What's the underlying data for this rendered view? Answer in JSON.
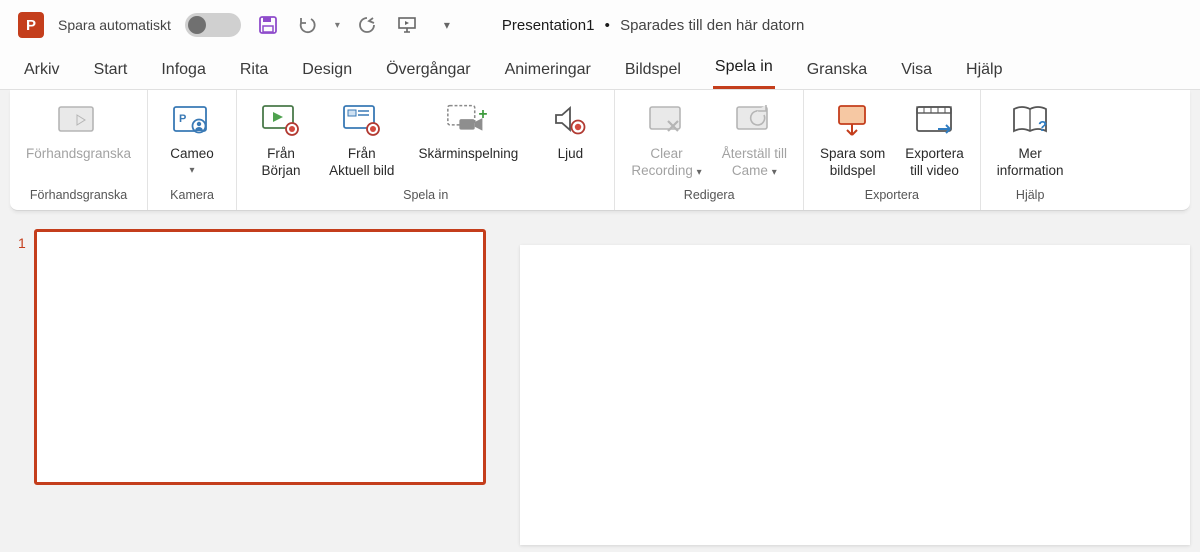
{
  "titlebar": {
    "autosave_label": "Spara automatiskt",
    "doc_title": "Presentation1",
    "separator": "•",
    "doc_status": "Sparades till den här datorn"
  },
  "tabs": {
    "items": [
      {
        "label": "Arkiv"
      },
      {
        "label": "Start"
      },
      {
        "label": "Infoga"
      },
      {
        "label": "Rita"
      },
      {
        "label": "Design"
      },
      {
        "label": "Övergångar"
      },
      {
        "label": "Animeringar"
      },
      {
        "label": "Bildspel"
      },
      {
        "label": "Spela in"
      },
      {
        "label": "Granska"
      },
      {
        "label": "Visa"
      },
      {
        "label": "Hjälp"
      }
    ],
    "active_index": 8
  },
  "ribbon": {
    "groups": [
      {
        "label": "Förhandsgranska",
        "buttons": [
          {
            "label": "Förhandsgranska",
            "disabled": true,
            "dropdown": false
          }
        ]
      },
      {
        "label": "Kamera",
        "buttons": [
          {
            "label": "Cameo",
            "disabled": false,
            "dropdown": true
          }
        ]
      },
      {
        "label": "Spela in",
        "buttons": [
          {
            "label": "Från\nBörjan",
            "disabled": false,
            "dropdown": false
          },
          {
            "label": "Från\nAktuell bild",
            "disabled": false,
            "dropdown": false
          },
          {
            "label": "Skärminspelning",
            "disabled": false,
            "dropdown": false
          },
          {
            "label": "Ljud",
            "disabled": false,
            "dropdown": false
          }
        ]
      },
      {
        "label": "Redigera",
        "buttons": [
          {
            "label": "Clear\nRecording",
            "disabled": true,
            "dropdown": true
          },
          {
            "label": "Återställ till\nCame",
            "disabled": true,
            "dropdown": true
          }
        ]
      },
      {
        "label": "Exportera",
        "buttons": [
          {
            "label": "Spara som\nbildspel",
            "disabled": false,
            "dropdown": false
          },
          {
            "label": "Exportera\ntill video",
            "disabled": false,
            "dropdown": false
          }
        ]
      },
      {
        "label": "Hjälp",
        "buttons": [
          {
            "label": "Mer\ninformation",
            "disabled": false,
            "dropdown": false
          }
        ]
      }
    ]
  },
  "editor": {
    "thumbnail_number": "1"
  },
  "colors": {
    "accent": "#c43e1c"
  }
}
